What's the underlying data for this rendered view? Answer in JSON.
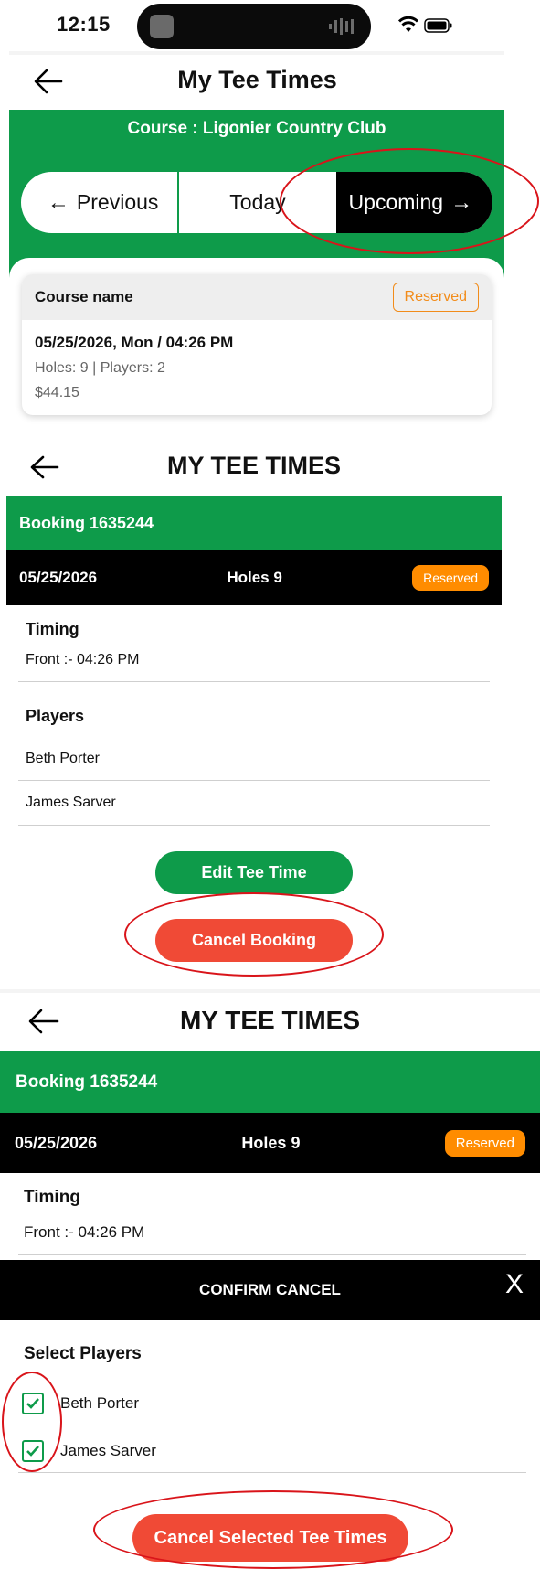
{
  "status_bar": {
    "time": "12:15"
  },
  "screen1": {
    "title": "My Tee Times",
    "course_line": "Course : Ligonier Country Club",
    "segments": [
      {
        "label": "Previous",
        "arrow": "←"
      },
      {
        "label": "Today"
      },
      {
        "label": "Upcoming",
        "arrow": "→"
      }
    ],
    "card": {
      "course_name": "Course name",
      "badge": "Reserved",
      "datetime": "05/25/2026, Mon / 04:26 PM",
      "meta": "Holes: 9 | Players: 2",
      "price": "$44.15"
    }
  },
  "screen2": {
    "title": "MY TEE TIMES",
    "booking": "Booking 1635244",
    "date": "05/25/2026",
    "holes": "Holes 9",
    "badge": "Reserved",
    "timing_label": "Timing",
    "timing_value": "Front :- 04:26 PM",
    "players_label": "Players",
    "players": [
      "Beth Porter",
      "James Sarver"
    ],
    "edit_button": "Edit Tee Time",
    "cancel_button": "Cancel Booking"
  },
  "screen3": {
    "title": "MY TEE TIMES",
    "booking": "Booking 1635244",
    "date": "05/25/2026",
    "holes": "Holes 9",
    "badge": "Reserved",
    "timing_label": "Timing",
    "timing_value": "Front :- 04:26 PM",
    "confirm_title": "CONFIRM CANCEL",
    "close_label": "X",
    "select_label": "Select Players",
    "players": [
      "Beth Porter",
      "James Sarver"
    ],
    "cancel_selected_button": "Cancel Selected Tee Times"
  },
  "colors": {
    "brand_green": "#0e9b4a",
    "reserved_orange": "#ff8c00",
    "cancel_red": "#f04a36",
    "annotation_red": "#d9141a"
  }
}
